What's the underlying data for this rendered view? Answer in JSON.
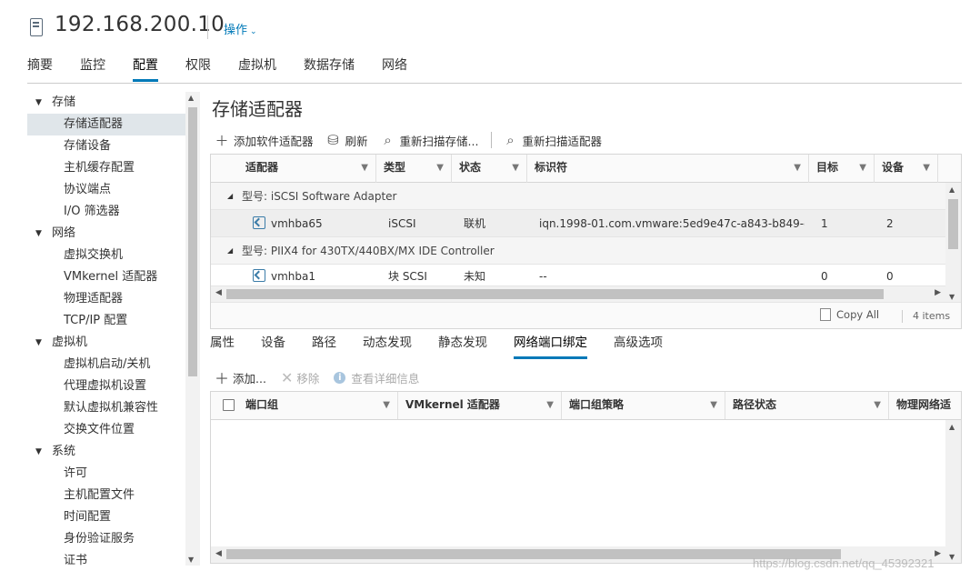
{
  "header": {
    "host_icon": "host-server-icon",
    "title": "192.168.200.10",
    "actions_label": "操作",
    "actions_chevron": "⌄"
  },
  "top_tabs": [
    {
      "label": "摘要"
    },
    {
      "label": "监控"
    },
    {
      "label": "配置",
      "active": true
    },
    {
      "label": "权限"
    },
    {
      "label": "虚拟机"
    },
    {
      "label": "数据存储"
    },
    {
      "label": "网络"
    }
  ],
  "nav": {
    "groups": [
      {
        "label": "存储",
        "items": [
          "存储适配器",
          "存储设备",
          "主机缓存配置",
          "协议端点",
          "I/O 筛选器"
        ]
      },
      {
        "label": "网络",
        "items": [
          "虚拟交换机",
          "VMkernel 适配器",
          "物理适配器",
          "TCP/IP 配置"
        ]
      },
      {
        "label": "虚拟机",
        "items": [
          "虚拟机启动/关机",
          "代理虚拟机设置",
          "默认虚拟机兼容性",
          "交换文件位置"
        ]
      },
      {
        "label": "系统",
        "items": [
          "许可",
          "主机配置文件",
          "时间配置",
          "身份验证服务",
          "证书"
        ]
      }
    ],
    "selected": "存储适配器"
  },
  "main": {
    "title": "存储适配器",
    "toolbar": {
      "add_software_adapter": "添加软件适配器",
      "refresh": "刷新",
      "rescan_storage": "重新扫描存储...",
      "rescan_adapter": "重新扫描适配器"
    },
    "adapters_grid": {
      "columns": [
        "适配器",
        "类型",
        "状态",
        "标识符",
        "目标",
        "设备"
      ],
      "groups": [
        {
          "label": "型号: iSCSI Software Adapter",
          "rows": [
            {
              "adapter": "vmhba65",
              "type": "iSCSI",
              "status": "联机",
              "identifier": "iqn.1998-01.com.vmware:5ed9e47c-a843-b849-d...",
              "targets": "1",
              "devices": "2",
              "selected": true
            }
          ]
        },
        {
          "label": "型号: PIIX4 for 430TX/440BX/MX IDE Controller",
          "rows": [
            {
              "adapter": "vmhba1",
              "type": "块 SCSI",
              "status": "未知",
              "identifier": "--",
              "targets": "0",
              "devices": "0",
              "selected": false
            }
          ]
        }
      ],
      "copy_all": "Copy All",
      "items_count": "4 items"
    },
    "detail_tabs": [
      {
        "label": "属性"
      },
      {
        "label": "设备"
      },
      {
        "label": "路径"
      },
      {
        "label": "动态发现"
      },
      {
        "label": "静态发现"
      },
      {
        "label": "网络端口绑定",
        "active": true
      },
      {
        "label": "高级选项"
      }
    ],
    "binding_toolbar": {
      "add": "添加...",
      "remove": "移除",
      "view_details": "查看详细信息"
    },
    "binding_grid": {
      "columns": [
        "端口组",
        "VMkernel 适配器",
        "端口组策略",
        "路径状态",
        "物理网络适"
      ]
    }
  },
  "watermark": "https://blog.csdn.net/qq_45392321",
  "colors": {
    "accent": "#0079b8",
    "selected_row": "#eeeeee",
    "selected_nav": "#e0e6ea"
  }
}
